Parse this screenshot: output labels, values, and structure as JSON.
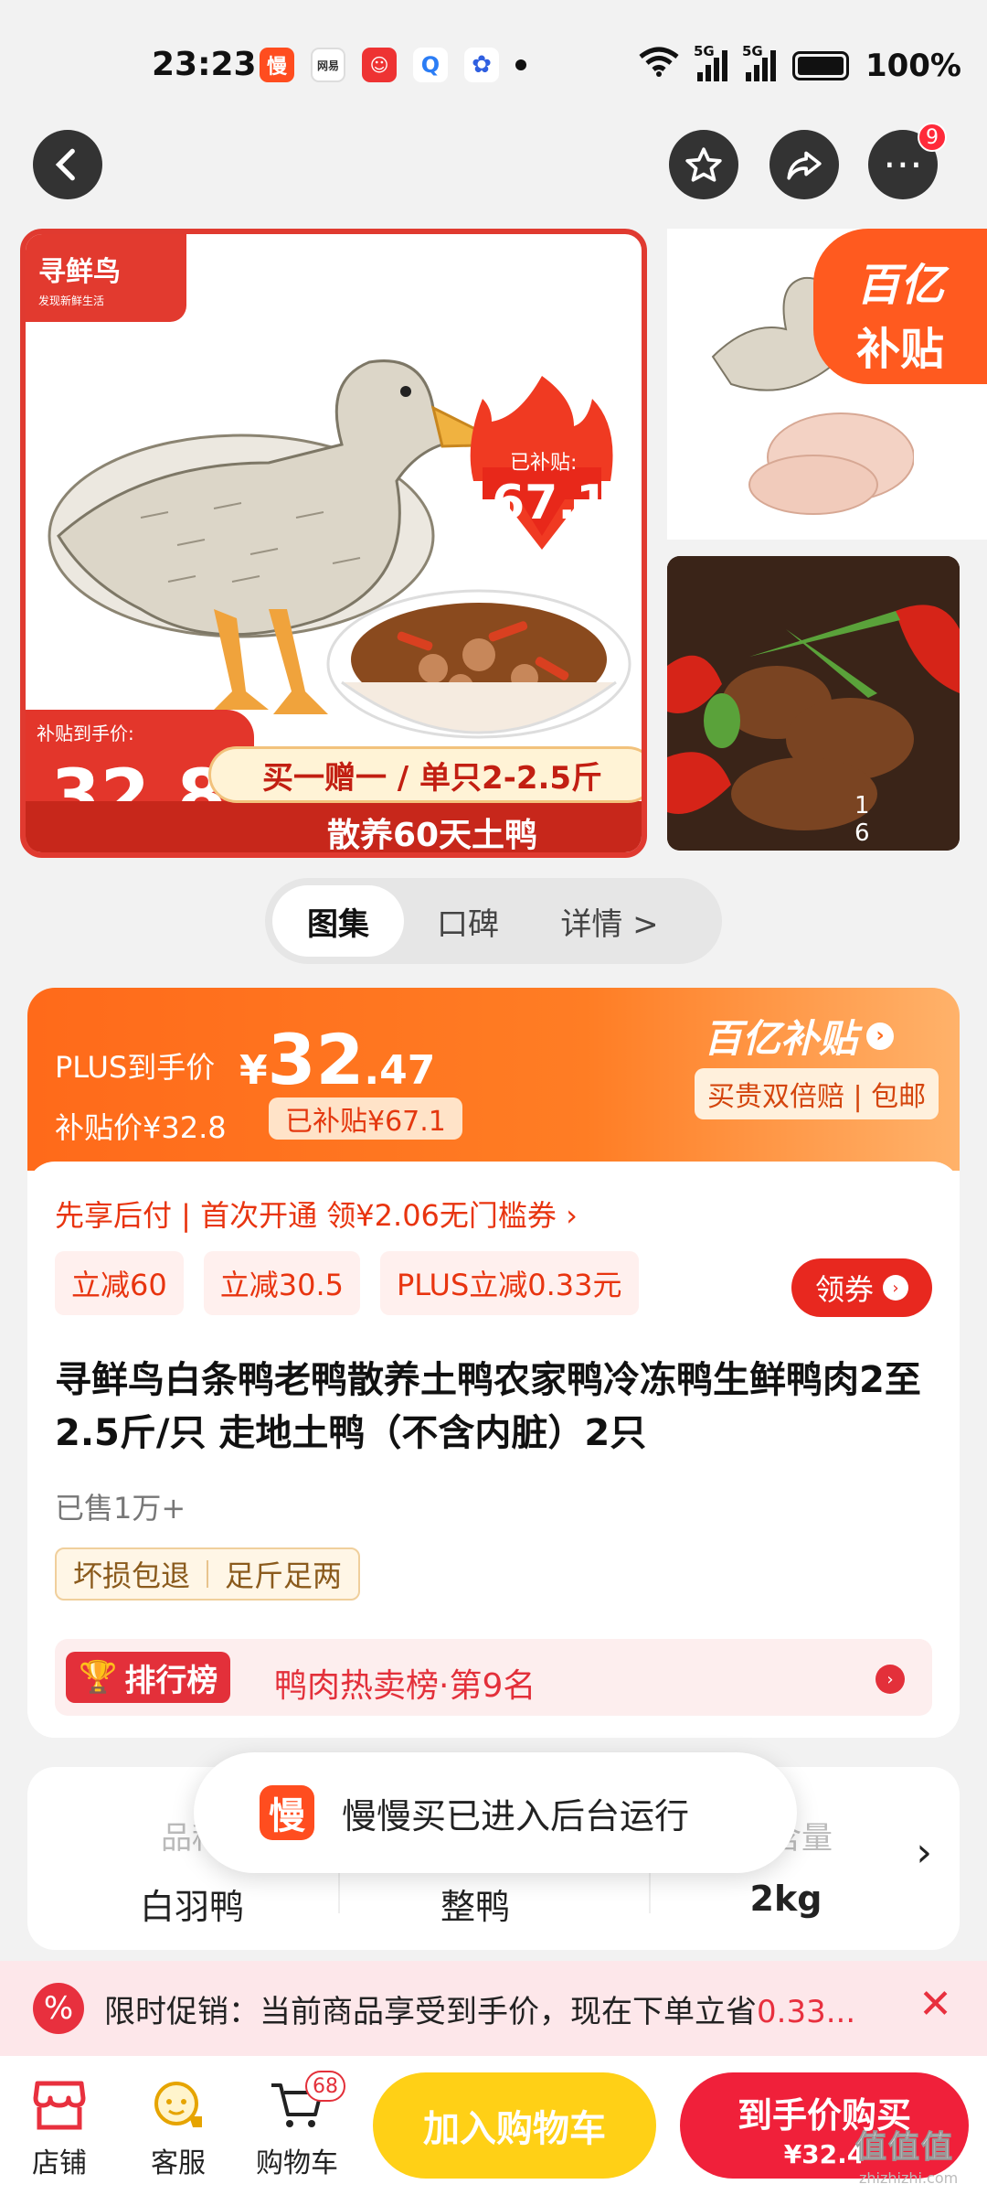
{
  "status_bar": {
    "time": "23:23",
    "notification_icons": [
      "slow-buy-app-icon",
      "netease-app-icon",
      "jd-app-icon",
      "search-app-icon",
      "baidu-app-icon",
      "more-dot-icon"
    ],
    "netease_text": "网易",
    "signal_1": "5G",
    "signal_2": "5G",
    "battery": "100%"
  },
  "header": {
    "cart_count": "9"
  },
  "gallery": {
    "brand_name": "寻鲜鸟",
    "brand_slogan": "发现新鲜生活",
    "subsidy_label": "已补贴:",
    "subsidy_value": "67.1",
    "price_caption": "补贴到手价:",
    "price_yen": "¥",
    "price_value": "32.8",
    "cta": "买一赠一 / 单只2-2.5斤",
    "slogan": "散养60天土鸭",
    "badge_line1": "百亿",
    "badge_line2": "补贴",
    "counter": "1 6"
  },
  "tabs": [
    {
      "label": "图集",
      "active": true
    },
    {
      "label": "口碑",
      "active": false
    },
    {
      "label": "详情 >",
      "active": false
    }
  ],
  "price": {
    "plus_label": "PLUS到手价",
    "plus_yen": "¥",
    "plus_int": "32",
    "plus_dec": ".47",
    "subsidy_price": "补贴价¥32.8",
    "subsidy_chip": "已补贴¥67.1",
    "program": "百亿补贴",
    "guarantee": "买贵双倍赔 | 包邮",
    "accent_color": "#ff6a1a"
  },
  "offers": {
    "pay_later": "先享后付 | 首次开通 领¥2.06无门槛券 ›",
    "coupons": [
      "立减60",
      "立减30.5",
      "PLUS立减0.33元"
    ],
    "get_coupon": "领券"
  },
  "product": {
    "title": "寻鲜鸟白条鸭老鸭散养土鸭农家鸭冷冻鸭生鲜鸭肉2至2.5斤/只 走地土鸭（不含内脏）2只",
    "sold": "已售1万+",
    "service_tags": [
      "坏损包退",
      "足斤足两"
    ],
    "rank_badge": "排行榜",
    "rank_text": "鸭肉热卖榜·第9名"
  },
  "specs": [
    {
      "key": "品种",
      "value": "白羽鸭"
    },
    {
      "key": "",
      "value": "整鸭"
    },
    {
      "key": "净含量",
      "value": "2kg"
    }
  ],
  "toast": {
    "logo": "慢",
    "text": "慢慢买已进入后台运行"
  },
  "promo": {
    "icon": "%",
    "label": "限时促销：当前商品享受到手价，现在下单立省",
    "highlight": "0.33..."
  },
  "bottom_bar": {
    "shop": "店铺",
    "service": "客服",
    "cart": "购物车",
    "cart_count": "68",
    "add_to_cart": "加入购物车",
    "buy_now": "到手价购买",
    "buy_now_price": "¥32.4"
  },
  "watermark": {
    "text": "值值值",
    "url": "zhizhizhi.com"
  }
}
